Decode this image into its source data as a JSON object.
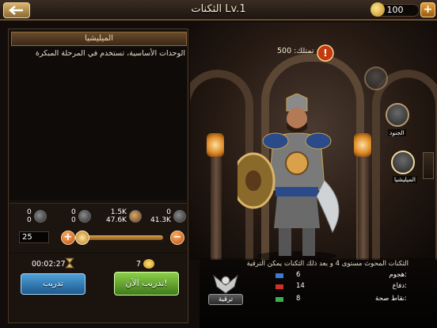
{
  "header": {
    "title": "الثكنات Lv.1",
    "gold": "100",
    "plus": "+"
  },
  "unit": {
    "name": "الميليشيا",
    "description": "الوحدات الأساسية، تستخدم في المرحلة المبكرة"
  },
  "resources": [
    {
      "top": "0",
      "bottom": "0"
    },
    {
      "top": "0",
      "bottom": "0"
    },
    {
      "top": "1.5K",
      "bottom": "47.6K"
    },
    {
      "top": "0",
      "bottom": "41.3K"
    }
  ],
  "training": {
    "quantity": "25",
    "minus": "−",
    "plus": "+",
    "time": "00:02:27",
    "food_cost": "7",
    "quantity_fraction": 1.0,
    "train_label": "تدريب",
    "train_now_label": "تدريب الآن!"
  },
  "scene": {
    "own_label": "تمتلك: 500",
    "badge": "!",
    "side_units": [
      "",
      "الجنود",
      "الميليشيا"
    ]
  },
  "info": {
    "text": "الثكنات المحوث مستوى 4 و بعد ذلك الثكنات يمكن الترقية",
    "stats": [
      {
        "label": "هجوم:",
        "value": "6",
        "color": "#3a7bd5"
      },
      {
        "label": "دفاع:",
        "value": "14",
        "color": "#d0302a"
      },
      {
        "label": "نقاط صحة:",
        "value": "8",
        "color": "#3ab04a"
      }
    ],
    "upgrade_label": "ترقية"
  },
  "colors": {
    "accent": "#d9a24a",
    "train_button": "#2f7ab8",
    "train_now_button": "#5a9e28"
  }
}
